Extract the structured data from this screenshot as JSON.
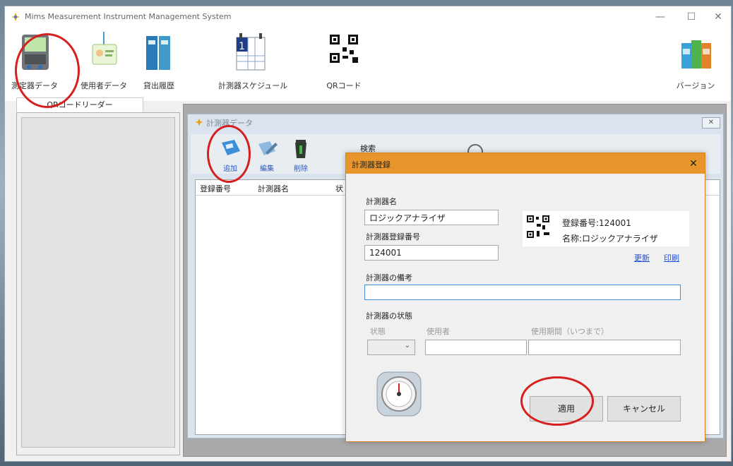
{
  "window": {
    "title": "Mims  Measurement Instrument Management System",
    "controls": {
      "minimize": "—",
      "maximize": "☐",
      "close": "✕"
    }
  },
  "toolbar": {
    "items": [
      {
        "label": "測定器データ",
        "icon": "instrument-meter-icon"
      },
      {
        "label": "使用者データ",
        "icon": "id-badge-icon"
      },
      {
        "label": "貸出履歴",
        "icon": "binders-icon"
      },
      {
        "label": "計測器スケジュール",
        "icon": "calendar-icon"
      },
      {
        "label": "QRコード",
        "icon": "qr-code-icon"
      },
      {
        "label": "バージョン",
        "icon": "books-icon"
      }
    ]
  },
  "left_panel": {
    "tab_label": "QRコードリーダー"
  },
  "child_window": {
    "title": "計測器データ",
    "toolbar": {
      "add": "追加",
      "edit": "編集",
      "delete": "削除",
      "search": "検索"
    },
    "grid_columns": [
      "登録番号",
      "計測器名",
      "状"
    ]
  },
  "dialog": {
    "title": "計測器登録",
    "close": "✕",
    "name_label": "計測器名",
    "name_value": "ロジックアナライザ",
    "reg_label": "計測器登録番号",
    "reg_value": "124001",
    "qr_line1": "登録番号:124001",
    "qr_line2": "名称:ロジックアナライザ",
    "update_link": "更新",
    "print_link": "印刷",
    "note_label": "計測器の備考",
    "note_value": "",
    "state_section": "計測器の状態",
    "state_col": "状態",
    "user_col": "使用者",
    "period_col": "使用期間（いつまで）",
    "apply": "適用",
    "cancel": "キャンセル"
  },
  "colors": {
    "dialog_title_bar": "#e8962c",
    "annotation": "#d62020",
    "link": "#1f4fd6"
  }
}
